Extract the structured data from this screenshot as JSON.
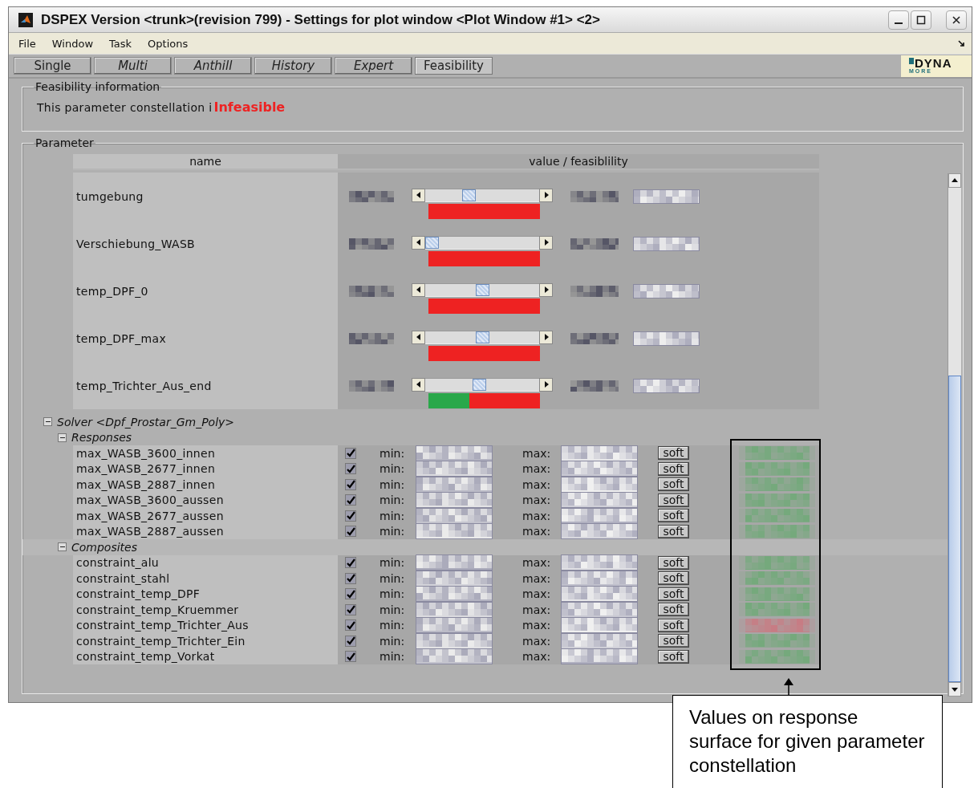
{
  "window": {
    "title": "DSPEX Version <trunk>(revision 799) - Settings for plot window  <Plot Window #1> <2>"
  },
  "menu": [
    "File",
    "Window",
    "Task",
    "Options"
  ],
  "tabs": [
    {
      "label": "Single",
      "selected": false,
      "disabled": false
    },
    {
      "label": "Multi",
      "selected": false,
      "disabled": true
    },
    {
      "label": "Anthill",
      "selected": false,
      "disabled": true
    },
    {
      "label": "History",
      "selected": false,
      "disabled": true
    },
    {
      "label": "Expert",
      "selected": false,
      "disabled": true
    },
    {
      "label": "Feasibility",
      "selected": true,
      "disabled": false
    }
  ],
  "logo": {
    "top": "DYNA",
    "bottom": "MORE"
  },
  "feasibility_info": {
    "title": "Feasibility information",
    "text": "This parameter constellation i",
    "status": "Infeasible"
  },
  "parameter": {
    "title": "Parameter",
    "columns": [
      "name",
      "value / feasiblility"
    ],
    "rows": [
      {
        "name": "tumgebung",
        "level": 0.37,
        "partly_feasible": false
      },
      {
        "name": "Verschiebung_WASB",
        "level": 0,
        "partly_feasible": false
      },
      {
        "name": "temp_DPF_0",
        "level": 0.5,
        "partly_feasible": false
      },
      {
        "name": "temp_DPF_max",
        "level": 0.5,
        "partly_feasible": false
      },
      {
        "name": "temp_Trichter_Aus_end",
        "level": 0.47,
        "partly_feasible": true
      }
    ]
  },
  "solver": {
    "label": "Solver <Dpf_Prostar_Gm_Poly>",
    "expanded": true,
    "children": [
      {
        "label": "Responses",
        "expanded": true,
        "rows": [
          {
            "name": "max_WASB_3600_innen",
            "checked": true,
            "min_label": "min:",
            "max_label": "max:",
            "button": "soft",
            "feasible": true
          },
          {
            "name": "max_WASB_2677_innen",
            "checked": true,
            "min_label": "min:",
            "max_label": "max:",
            "button": "soft",
            "feasible": true
          },
          {
            "name": "max_WASB_2887_innen",
            "checked": true,
            "min_label": "min:",
            "max_label": "max:",
            "button": "soft",
            "feasible": true
          },
          {
            "name": "max_WASB_3600_aussen",
            "checked": true,
            "min_label": "min:",
            "max_label": "max:",
            "button": "soft",
            "feasible": true
          },
          {
            "name": "max_WASB_2677_aussen",
            "checked": true,
            "min_label": "min:",
            "max_label": "max:",
            "button": "soft",
            "feasible": true
          },
          {
            "name": "max_WASB_2887_aussen",
            "checked": true,
            "min_label": "min:",
            "max_label": "max:",
            "button": "soft",
            "feasible": true
          }
        ]
      },
      {
        "label": "Composites",
        "expanded": true,
        "rows": [
          {
            "name": "constraint_alu",
            "checked": true,
            "min_label": "min:",
            "max_label": "max:",
            "button": "soft",
            "feasible": true
          },
          {
            "name": "constraint_stahl",
            "checked": true,
            "min_label": "min:",
            "max_label": "max:",
            "button": "soft",
            "feasible": true
          },
          {
            "name": "constraint_temp_DPF",
            "checked": true,
            "min_label": "min:",
            "max_label": "max:",
            "button": "soft",
            "feasible": true
          },
          {
            "name": "constraint_temp_Kruemmer",
            "checked": true,
            "min_label": "min:",
            "max_label": "max:",
            "button": "soft",
            "feasible": true
          },
          {
            "name": "constraint_temp_Trichter_Aus",
            "checked": true,
            "min_label": "min:",
            "max_label": "max:",
            "button": "soft",
            "feasible": false
          },
          {
            "name": "constraint_temp_Trichter_Ein",
            "checked": true,
            "min_label": "min:",
            "max_label": "max:",
            "button": "soft",
            "feasible": true
          },
          {
            "name": "constraint_temp_Vorkat",
            "checked": true,
            "min_label": "min:",
            "max_label": "max:",
            "button": "soft",
            "feasible": true
          }
        ]
      }
    ]
  },
  "callout": {
    "text": "Values on response surface for given parameter constellation"
  }
}
